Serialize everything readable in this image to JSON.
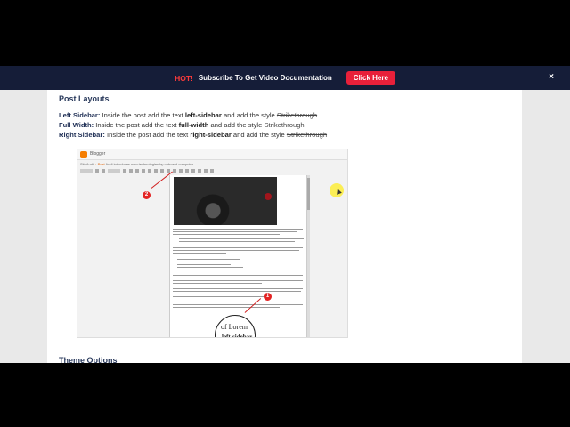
{
  "promo": {
    "hot": "HOT!",
    "message": "Subscribe To Get Video Documentation",
    "button": "Click Here",
    "close": "×"
  },
  "section_title": "Post Layouts",
  "layouts": [
    {
      "label": "Left Sidebar:",
      "pre": "Inside the post add the text",
      "keyword": "left-sidebar",
      "mid": "and add the style",
      "style": "Strikethrough"
    },
    {
      "label": "Full Width:",
      "pre": "Inside the post add the text",
      "keyword": "full-width",
      "mid": "and add the style",
      "style": "Strikethrough"
    },
    {
      "label": "Right Sidebar:",
      "pre": "Inside the post add the text",
      "keyword": "right-sidebar",
      "mid": "and add the style",
      "style": "Strikethrough"
    }
  ],
  "next_section": "Theme Options",
  "screenshot": {
    "app": "Blogger",
    "blog_name": "SiteAudit",
    "post_label": "· Post",
    "post_title": "Audi introduces new technologies by onboard computer",
    "callouts": [
      "1",
      "2"
    ],
    "magnifier_text": "of Lorem",
    "magnifier_keyword": "left-sidebar"
  },
  "colors": {
    "promo_bg": "#151d38",
    "hot": "#ff3b3b",
    "button": "#e8203a",
    "heading": "#2a3a5c"
  }
}
